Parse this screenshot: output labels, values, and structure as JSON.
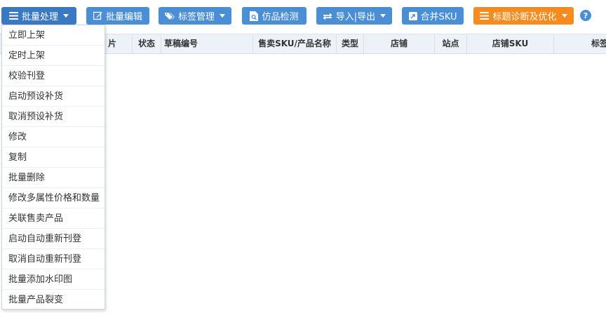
{
  "toolbar": {
    "batch_process_label": "批量处理",
    "batch_edit_label": "批量编辑",
    "tag_manage_label": "标签管理",
    "counterfeit_check_label": "仿品检测",
    "import_export_label": "导入|导出",
    "merge_sku_label": "合并SKU",
    "title_optimize_label": "标题诊断及优化",
    "help_label": "?"
  },
  "table": {
    "columns": [
      "片",
      "状态",
      "草稿编号",
      "售卖SKU/产品名称",
      "类型",
      "店铺",
      "站点",
      "店铺SKU",
      "标签"
    ]
  },
  "batch_menu": {
    "items": [
      "立即上架",
      "定时上架",
      "校验刊登",
      "启动预设补货",
      "取消预设补货",
      "修改",
      "复制",
      "批量删除",
      "修改多属性价格和数量",
      "关联售卖产品",
      "启动自动重新刊登",
      "取消自动重新刊登",
      "批量添加水印图",
      "批量产品裂变"
    ]
  },
  "colors": {
    "primary": "#4a8fd6",
    "primary_dark": "#3a78c2",
    "warning": "#f68c1f",
    "header_bg": "#eef2f8"
  }
}
